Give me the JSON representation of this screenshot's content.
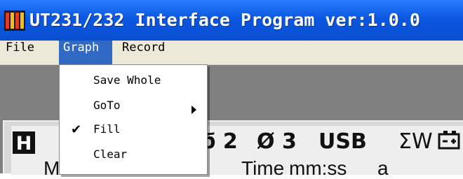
{
  "window": {
    "title": "UT231/232 Interface Program ver:1.0.0"
  },
  "menubar": {
    "items": [
      {
        "label": "File"
      },
      {
        "label": "Graph"
      },
      {
        "label": "Record"
      }
    ]
  },
  "graph_menu": {
    "items": [
      {
        "label": "Save Whole",
        "checked": false,
        "submenu": false
      },
      {
        "label": "GoTo",
        "checked": false,
        "submenu": true
      },
      {
        "label": "Fill",
        "checked": true,
        "submenu": false
      },
      {
        "label": "Clear",
        "checked": false,
        "submenu": false
      }
    ],
    "check_glyph": "✔"
  },
  "display": {
    "hold": "H",
    "phase2": "ϭ 2",
    "phase3": "Ø 3",
    "usb": "USB",
    "sum_w": "ΣW",
    "partial_m": "M",
    "time_label": "Time",
    "time_unit": "mm:ss",
    "partial_a": "a"
  },
  "colors": {
    "titlebar": "#0b57e0",
    "menu_highlight": "#316ac5",
    "menubar": "#ece9d8",
    "workarea": "#808080"
  }
}
